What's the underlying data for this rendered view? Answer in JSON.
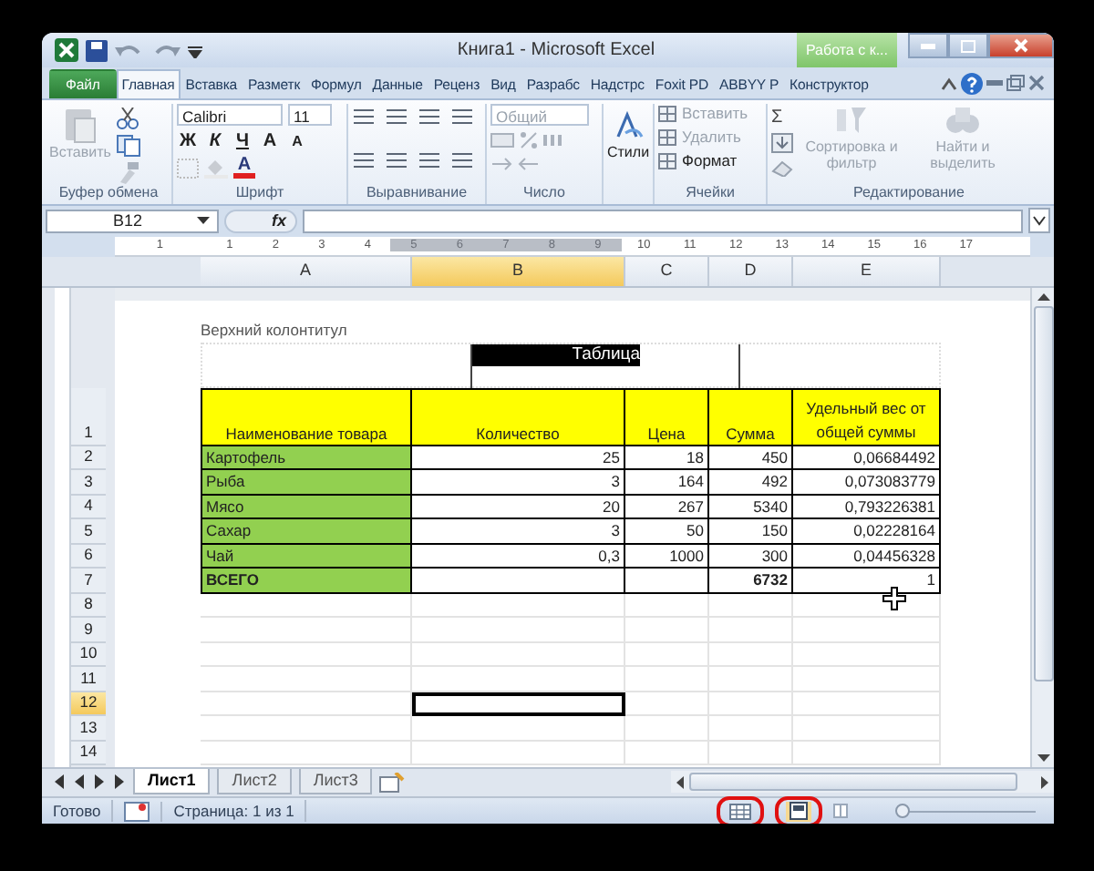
{
  "window": {
    "title": "Книга1  -  Microsoft Excel",
    "context_tab": "Работа с к..."
  },
  "ribbon_tabs": [
    {
      "label": "Файл",
      "kind": "file",
      "selected": false
    },
    {
      "label": "Главная",
      "kind": "tab",
      "selected": true
    },
    {
      "label": "Вставка",
      "kind": "tab",
      "selected": false
    },
    {
      "label": "Разметк",
      "kind": "tab",
      "selected": false
    },
    {
      "label": "Формул",
      "kind": "tab",
      "selected": false
    },
    {
      "label": "Данные",
      "kind": "tab",
      "selected": false
    },
    {
      "label": "Реценз",
      "kind": "tab",
      "selected": false
    },
    {
      "label": "Вид",
      "kind": "tab",
      "selected": false
    },
    {
      "label": "Разрабс",
      "kind": "tab",
      "selected": false
    },
    {
      "label": "Надстрс",
      "kind": "tab",
      "selected": false
    },
    {
      "label": "Foxit PD",
      "kind": "tab",
      "selected": false
    },
    {
      "label": "ABBYY P",
      "kind": "tab",
      "selected": false
    },
    {
      "label": "Конструктор",
      "kind": "context",
      "selected": false
    }
  ],
  "clipboard": {
    "paste": "Вставить",
    "paste_disabled": true,
    "label": "Буфер обмена"
  },
  "font": {
    "family": "Calibri",
    "size": "11",
    "styles": [
      "Ж",
      "К",
      "Ч"
    ],
    "grow": "A",
    "shrink": "A",
    "color_letter": "A",
    "label": "Шрифт"
  },
  "alignment": {
    "label": "Выравнивание"
  },
  "number": {
    "format": "Общий",
    "format_disabled": true,
    "label": "Число"
  },
  "styles": {
    "button": "Стили"
  },
  "cells": {
    "items": [
      {
        "label": "Вставить",
        "disabled": true
      },
      {
        "label": "Удалить",
        "disabled": true
      },
      {
        "label": "Формат",
        "disabled": false
      }
    ],
    "label": "Ячейки"
  },
  "editing": {
    "sum": "Σ",
    "sort": "Сортировка и фильтр",
    "find": "Найти и выделить",
    "disabled": true,
    "label": "Редактирование"
  },
  "formula_bar": {
    "name_box": "B12",
    "fx": "fx"
  },
  "ruler": [
    "1",
    "1",
    "2",
    "3",
    "4",
    "5",
    "6",
    "7",
    "8",
    "9",
    "10",
    "11",
    "12",
    "13",
    "14",
    "15",
    "16",
    "17"
  ],
  "columns": [
    {
      "label": "A",
      "selected": false
    },
    {
      "label": "B",
      "selected": true
    },
    {
      "label": "C",
      "selected": false
    },
    {
      "label": "D",
      "selected": false
    },
    {
      "label": "E",
      "selected": false
    }
  ],
  "page_header": {
    "label": "Верхний колонтитул",
    "text": "Таблица"
  },
  "table": {
    "header": [
      "Наименование товара",
      "Количество",
      "Цена",
      "Сумма",
      "Удельный вес от общей суммы"
    ],
    "rows": [
      {
        "kind": "item",
        "name": "Картофель",
        "quantity": "25",
        "price": "18",
        "sum": "450",
        "share": "0,06684492"
      },
      {
        "kind": "item",
        "name": "Рыба",
        "quantity": "3",
        "price": "164",
        "sum": "492",
        "share": "0,073083779"
      },
      {
        "kind": "item",
        "name": "Мясо",
        "quantity": "20",
        "price": "267",
        "sum": "5340",
        "share": "0,793226381"
      },
      {
        "kind": "item",
        "name": "Сахар",
        "quantity": "3",
        "price": "50",
        "sum": "150",
        "share": "0,02228164"
      },
      {
        "kind": "item",
        "name": "Чай",
        "quantity": "0,3",
        "price": "1000",
        "sum": "300",
        "share": "0,04456328"
      },
      {
        "kind": "total",
        "name": "ВСЕГО",
        "sum": "6732",
        "share": "1"
      }
    ]
  },
  "row_headers": [
    {
      "label": "1",
      "selected": false
    },
    {
      "label": "2",
      "selected": false
    },
    {
      "label": "3",
      "selected": false
    },
    {
      "label": "4",
      "selected": false
    },
    {
      "label": "5",
      "selected": false
    },
    {
      "label": "6",
      "selected": false
    },
    {
      "label": "7",
      "selected": false
    },
    {
      "label": "8",
      "selected": false
    },
    {
      "label": "9",
      "selected": false
    },
    {
      "label": "10",
      "selected": false
    },
    {
      "label": "11",
      "selected": false
    },
    {
      "label": "12",
      "selected": true
    },
    {
      "label": "13",
      "selected": false
    },
    {
      "label": "14",
      "selected": false
    }
  ],
  "sheet_tabs": [
    {
      "label": "Лист1",
      "selected": true
    },
    {
      "label": "Лист2",
      "selected": false
    },
    {
      "label": "Лист3",
      "selected": false
    }
  ],
  "status_bar": {
    "ready": "Готово",
    "page": "Страница: 1 из 1",
    "view_buttons": [
      {
        "kind": "normal",
        "selected": false,
        "annotated": true
      },
      {
        "kind": "page_layout",
        "selected": true,
        "annotated": true
      },
      {
        "kind": "page_break",
        "selected": false,
        "annotated": false
      }
    ],
    "zoom_slider": {
      "level": 0.04
    }
  }
}
